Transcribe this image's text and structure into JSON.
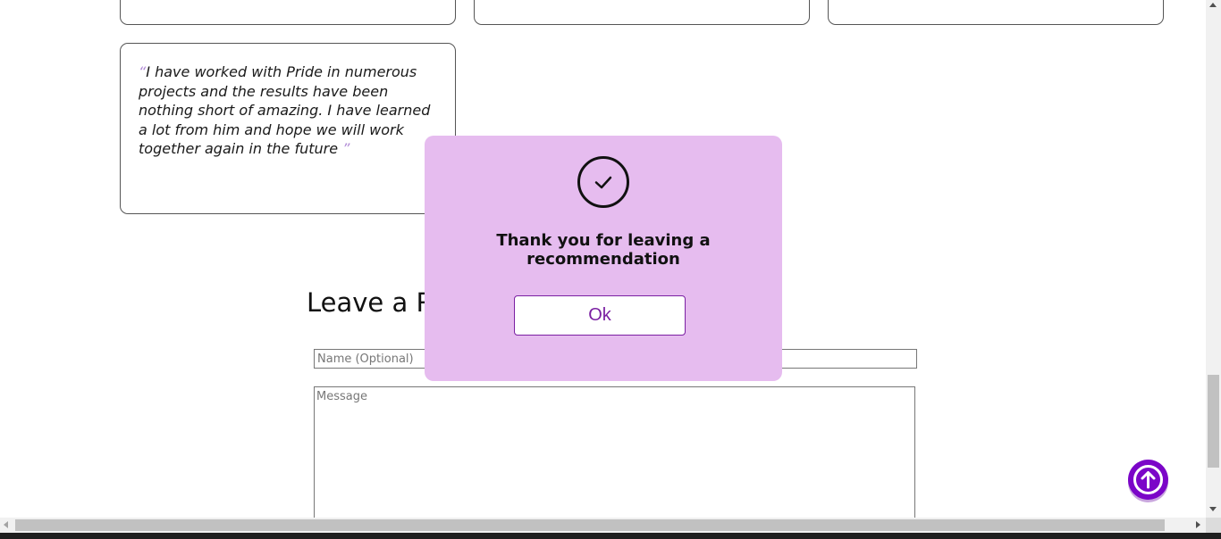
{
  "testimonial": {
    "open_quote": "“",
    "text": "I have worked with Pride in numerous projects and the results have been nothing short of amazing. I have learned a lot from him and hope we will work together again in the future ",
    "close_quote": "”"
  },
  "form": {
    "title_visible": "Leave a Re",
    "name_placeholder": "Name (Optional)",
    "message_placeholder": "Message"
  },
  "modal": {
    "message": "Thank you for leaving a recommendation",
    "ok_label": "Ok",
    "icon": "check-circle-icon"
  },
  "scroll_top": {
    "icon": "arrow-up-icon"
  },
  "colors": {
    "modal_bg": "#e6bcef",
    "accent": "#7b05c8",
    "ok_text": "#7a1fa2"
  }
}
